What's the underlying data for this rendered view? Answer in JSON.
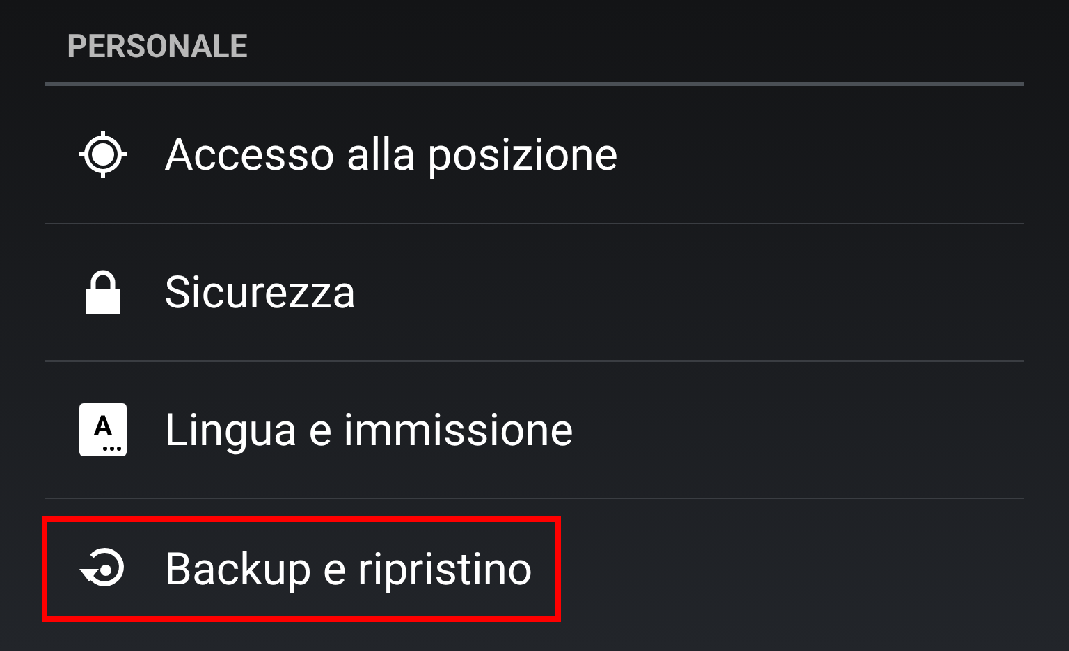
{
  "section": {
    "title": "PERSONALE"
  },
  "items": [
    {
      "label": "Accesso alla posizione",
      "highlighted": false
    },
    {
      "label": "Sicurezza",
      "highlighted": false
    },
    {
      "label": "Lingua e immissione",
      "icon_text": "A",
      "highlighted": false
    },
    {
      "label": "Backup e ripristino",
      "highlighted": true
    }
  ]
}
